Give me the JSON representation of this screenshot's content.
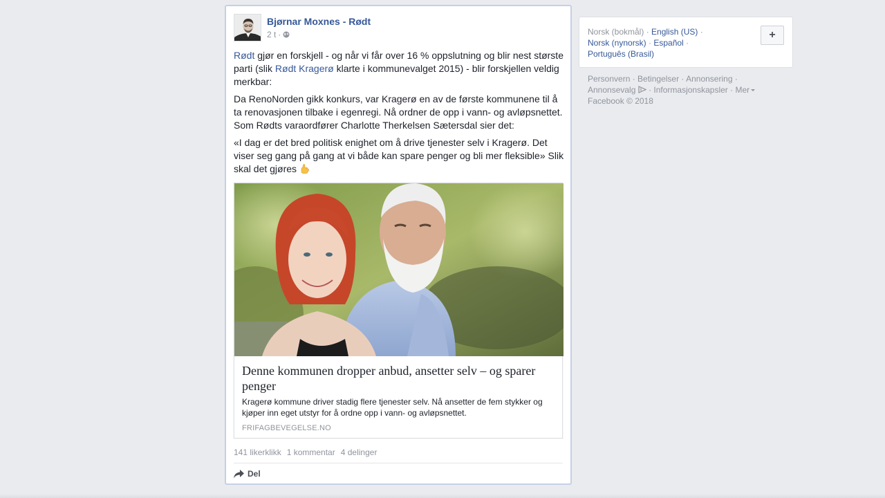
{
  "post": {
    "author": "Bjørnar Moxnes - Rødt",
    "time": "2 t",
    "time_separator": "·",
    "paragraph1": {
      "link1": "Rødt",
      "text1": " gjør en forskjell - og når vi får over 16 % oppslutning og blir nest største parti (slik ",
      "link2": "Rødt Kragerø",
      "text2": " klarte i kommunevalget 2015) - blir forskjellen veldig merkbar:"
    },
    "paragraph2": "Da RenoNorden gikk konkurs, var Kragerø en av de første kommunene til å ta renovasjonen tilbake i egenregi. Nå ordner de opp i vann- og avløpsnettet. Som Rødts varaordfører Charlotte Therkelsen Sætersdal sier det:",
    "paragraph3": "«I dag er det bred politisk enighet om å drive tjenester selv i Kragerø. Det viser seg gang på gang at vi både kan spare penger og bli mer fleksible» Slik skal det gjøres",
    "emoji_icon": "pointing-hand-emoji"
  },
  "link_preview": {
    "title": "Denne kommunen dropper anbud, ansetter selv – og sparer penger",
    "description": "Kragerø kommune driver stadig flere tjenester selv. Nå ansetter de fem stykker og kjøper inn eget utstyr for å ordne opp i vann- og avløpsnettet.",
    "domain": "FRIFAGBEVEGELSE.NO"
  },
  "stats": {
    "likes": "141 likerklikk",
    "comments": "1 kommentar",
    "shares": "4 delinger"
  },
  "actions": {
    "share_label": "Del",
    "share_icon": "share-arrow-icon"
  },
  "languages": {
    "current": "Norsk (bokmål)",
    "options": [
      "English (US)",
      "Norsk (nynorsk)",
      "Español",
      "Português (Brasil)"
    ],
    "add_label": "+"
  },
  "footer": {
    "links": [
      "Personvern",
      "Betingelser",
      "Annonsering",
      "Annonsevalg",
      "Informasjonskapsler",
      "Mer"
    ],
    "copyright": "Facebook © 2018"
  },
  "colors": {
    "background": "#e9ebee",
    "link": "#365899",
    "muted": "#90949c",
    "card_border": "#c5d0e6"
  }
}
